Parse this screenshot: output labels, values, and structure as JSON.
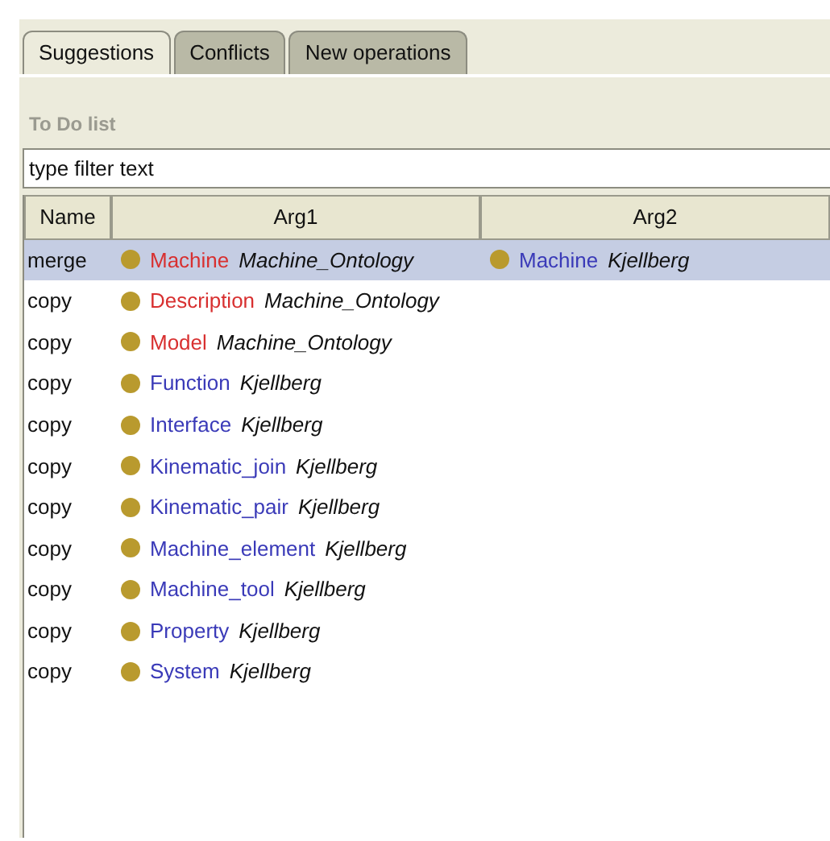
{
  "tabs": [
    {
      "label": "Suggestions",
      "selected": true
    },
    {
      "label": "Conflicts",
      "selected": false
    },
    {
      "label": "New operations",
      "selected": false
    }
  ],
  "section_label": "To Do list",
  "filter": {
    "value": "type filter text"
  },
  "columns": [
    "Name",
    "Arg1",
    "Arg2"
  ],
  "rows": [
    {
      "name": "merge",
      "selected": true,
      "arg1": {
        "term": "Machine",
        "color": "#d83030",
        "ontology": "Machine_Ontology"
      },
      "arg2": {
        "term": "Machine",
        "color": "#3a3ab8",
        "ontology": "Kjellberg"
      }
    },
    {
      "name": "copy",
      "selected": false,
      "arg1": {
        "term": "Description",
        "color": "#d83030",
        "ontology": "Machine_Ontology"
      }
    },
    {
      "name": "copy",
      "selected": false,
      "arg1": {
        "term": "Model",
        "color": "#d83030",
        "ontology": "Machine_Ontology"
      }
    },
    {
      "name": "copy",
      "selected": false,
      "arg1": {
        "term": "Function",
        "color": "#3a3ab8",
        "ontology": "Kjellberg"
      }
    },
    {
      "name": "copy",
      "selected": false,
      "arg1": {
        "term": "Interface",
        "color": "#3a3ab8",
        "ontology": "Kjellberg"
      }
    },
    {
      "name": "copy",
      "selected": false,
      "arg1": {
        "term": "Kinematic_join",
        "color": "#3a3ab8",
        "ontology": "Kjellberg"
      }
    },
    {
      "name": "copy",
      "selected": false,
      "arg1": {
        "term": "Kinematic_pair",
        "color": "#3a3ab8",
        "ontology": "Kjellberg"
      }
    },
    {
      "name": "copy",
      "selected": false,
      "arg1": {
        "term": "Machine_element",
        "color": "#3a3ab8",
        "ontology": "Kjellberg"
      }
    },
    {
      "name": "copy",
      "selected": false,
      "arg1": {
        "term": "Machine_tool",
        "color": "#3a3ab8",
        "ontology": "Kjellberg"
      }
    },
    {
      "name": "copy",
      "selected": false,
      "arg1": {
        "term": "Property",
        "color": "#3a3ab8",
        "ontology": "Kjellberg"
      }
    },
    {
      "name": "copy",
      "selected": false,
      "arg1": {
        "term": "System",
        "color": "#3a3ab8",
        "ontology": "Kjellberg"
      }
    }
  ]
}
